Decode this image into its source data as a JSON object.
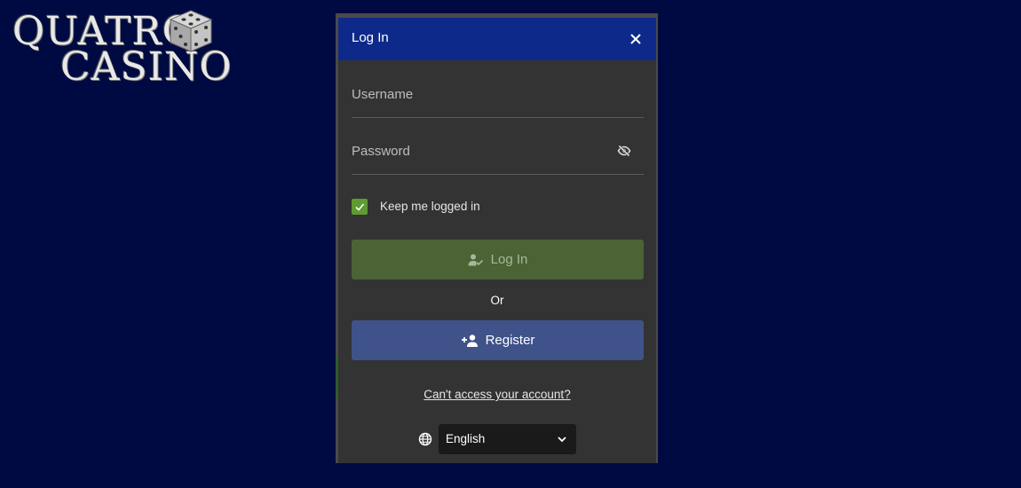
{
  "brand": {
    "line1": "QUATRO",
    "line2": "CASINO"
  },
  "modal": {
    "title": "Log In",
    "close_icon": "close-icon"
  },
  "form": {
    "username_placeholder": "Username",
    "username_value": "",
    "password_placeholder": "Password",
    "password_value": "",
    "password_toggle_icon": "eye-off-icon",
    "keep_logged_in_label": "Keep me logged in",
    "keep_logged_in_checked": true,
    "login_label": "Log In",
    "or_label": "Or",
    "register_label": "Register",
    "cant_access_label": "Can't access your account?"
  },
  "language": {
    "icon": "globe-icon",
    "selected": "English"
  },
  "colors": {
    "page_background": "#000a42",
    "header": "#0d2a8a",
    "login_button": "#4b6335",
    "register_button": "#3f5289",
    "checkbox": "#5f9a32"
  }
}
